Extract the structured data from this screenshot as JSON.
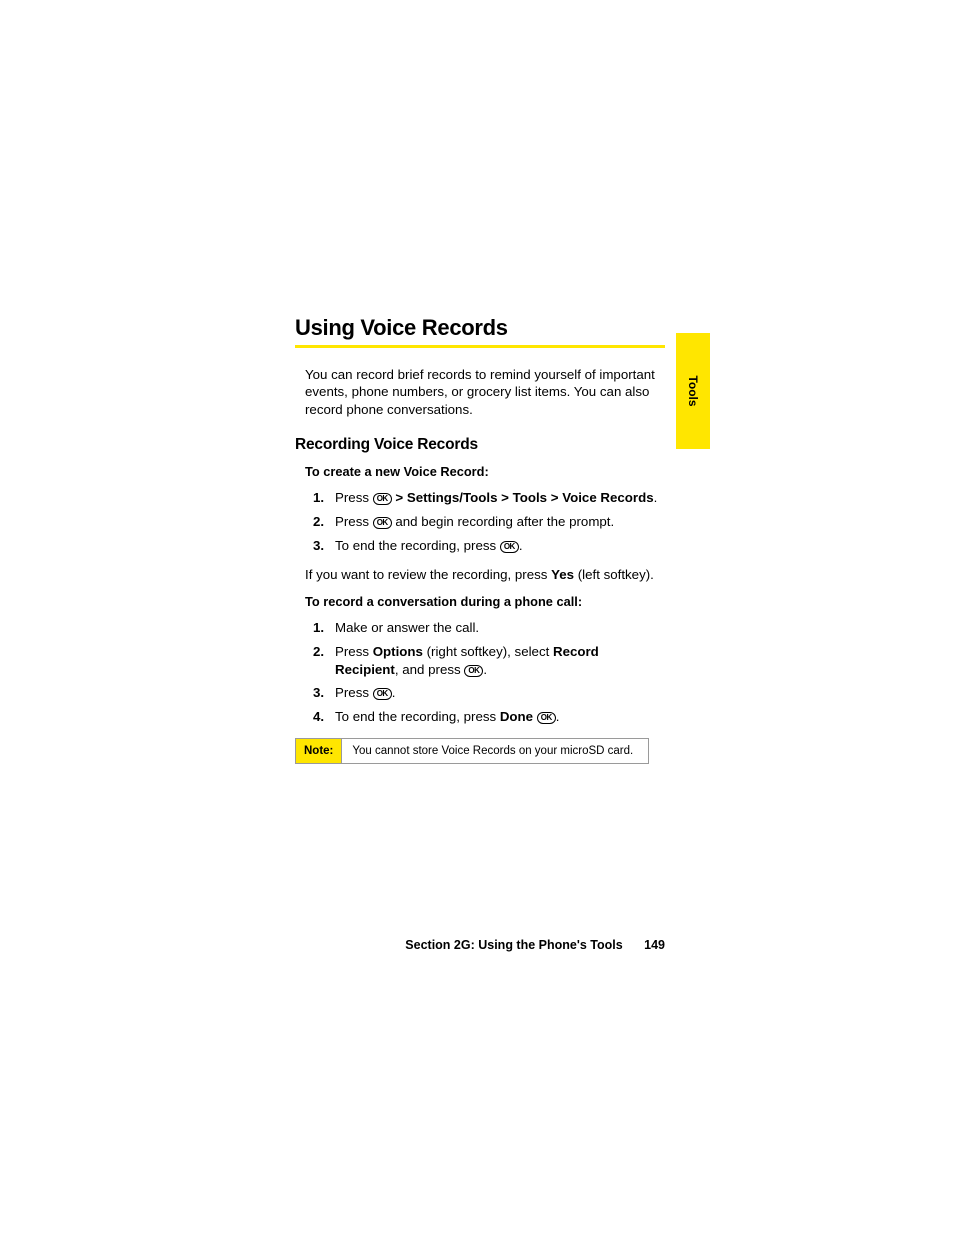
{
  "title": "Using Voice Records",
  "intro": "You can record brief records to remind yourself of important events, phone numbers, or grocery list items. You can also record phone conversations.",
  "sub_title": "Recording Voice Records",
  "lead1": "To create a new Voice Record:",
  "steps1": {
    "s1a": "Press ",
    "s1b": " > Settings/Tools > Tools > Voice Records",
    "s1c": ".",
    "s2a": "Press ",
    "s2b": " and begin recording after the prompt.",
    "s3a": "To end the recording, press ",
    "s3b": "."
  },
  "review_a": "If you want to review the recording, press ",
  "review_b": "Yes",
  "review_c": " (left softkey).",
  "lead2": "To record a conversation during a phone call:",
  "steps2": {
    "s1": "Make or answer the call.",
    "s2a": "Press ",
    "s2b": "Options",
    "s2c": " (right softkey), select ",
    "s2d": "Record Recipient",
    "s2e": ", and press ",
    "s2f": ".",
    "s3a": "Press ",
    "s3b": ".",
    "s4a": "To end the recording, press ",
    "s4b": "Done",
    "s4c": " ",
    "s4d": "."
  },
  "note_label": "Note:",
  "note_text": "You cannot store Voice Records on your microSD card.",
  "side_tab": "Tools",
  "footer_section": "Section 2G: Using the Phone's Tools",
  "footer_page": "149",
  "key_glyph": "OK",
  "nums": {
    "n1": "1.",
    "n2": "2.",
    "n3": "3.",
    "n4": "4."
  }
}
